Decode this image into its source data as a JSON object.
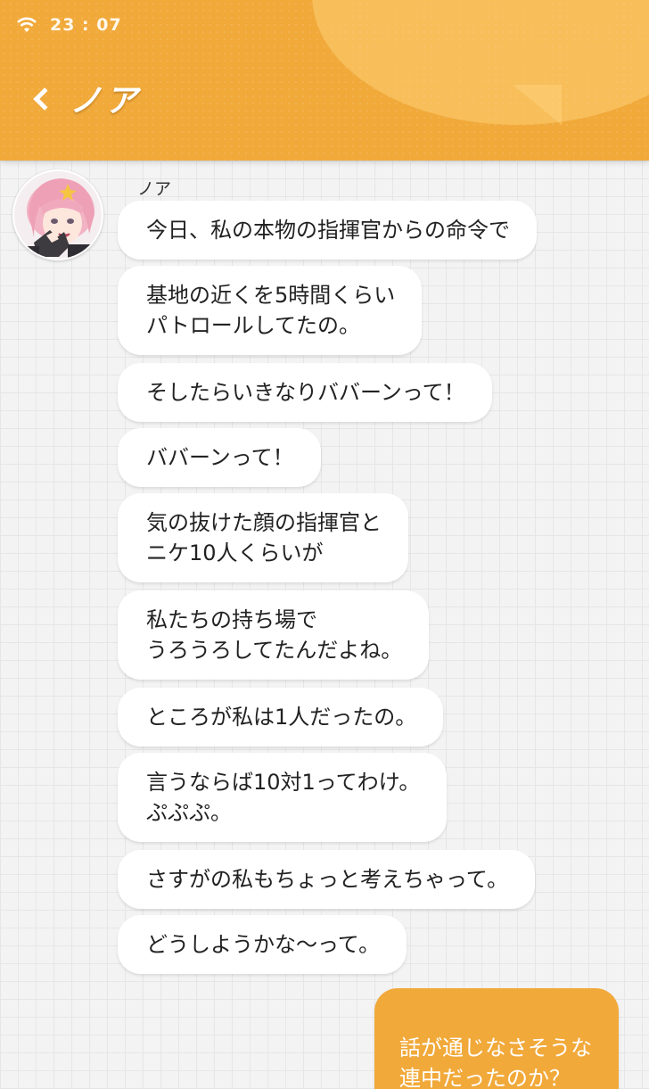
{
  "status_bar": {
    "time": "23 : 07"
  },
  "header": {
    "title": "ノア"
  },
  "chat": {
    "sender_name": "ノア",
    "messages": [
      {
        "text": "今日、私の本物の指揮官からの命令で"
      },
      {
        "text": "基地の近くを5時間くらい\nパトロールしてたの。"
      },
      {
        "text": "そしたらいきなりババーンって！"
      },
      {
        "text": "ババーンって！"
      },
      {
        "text": "気の抜けた顔の指揮官と\nニケ10人くらいが"
      },
      {
        "text": "私たちの持ち場で\nうろうろしてたんだよね。"
      },
      {
        "text": "ところが私は1人だったの。"
      },
      {
        "text": "言うならば10対1ってわけ。\nぷぷぷ。"
      },
      {
        "text": "さすがの私もちょっと考えちゃって。"
      },
      {
        "text": "どうしようかな～って。"
      }
    ],
    "reply": {
      "text": "話が通じなさそうな\n連中だったのか？"
    }
  },
  "colors": {
    "accent": "#f1a93a",
    "bubble": "#ffffff",
    "background": "#f3f3f3"
  }
}
